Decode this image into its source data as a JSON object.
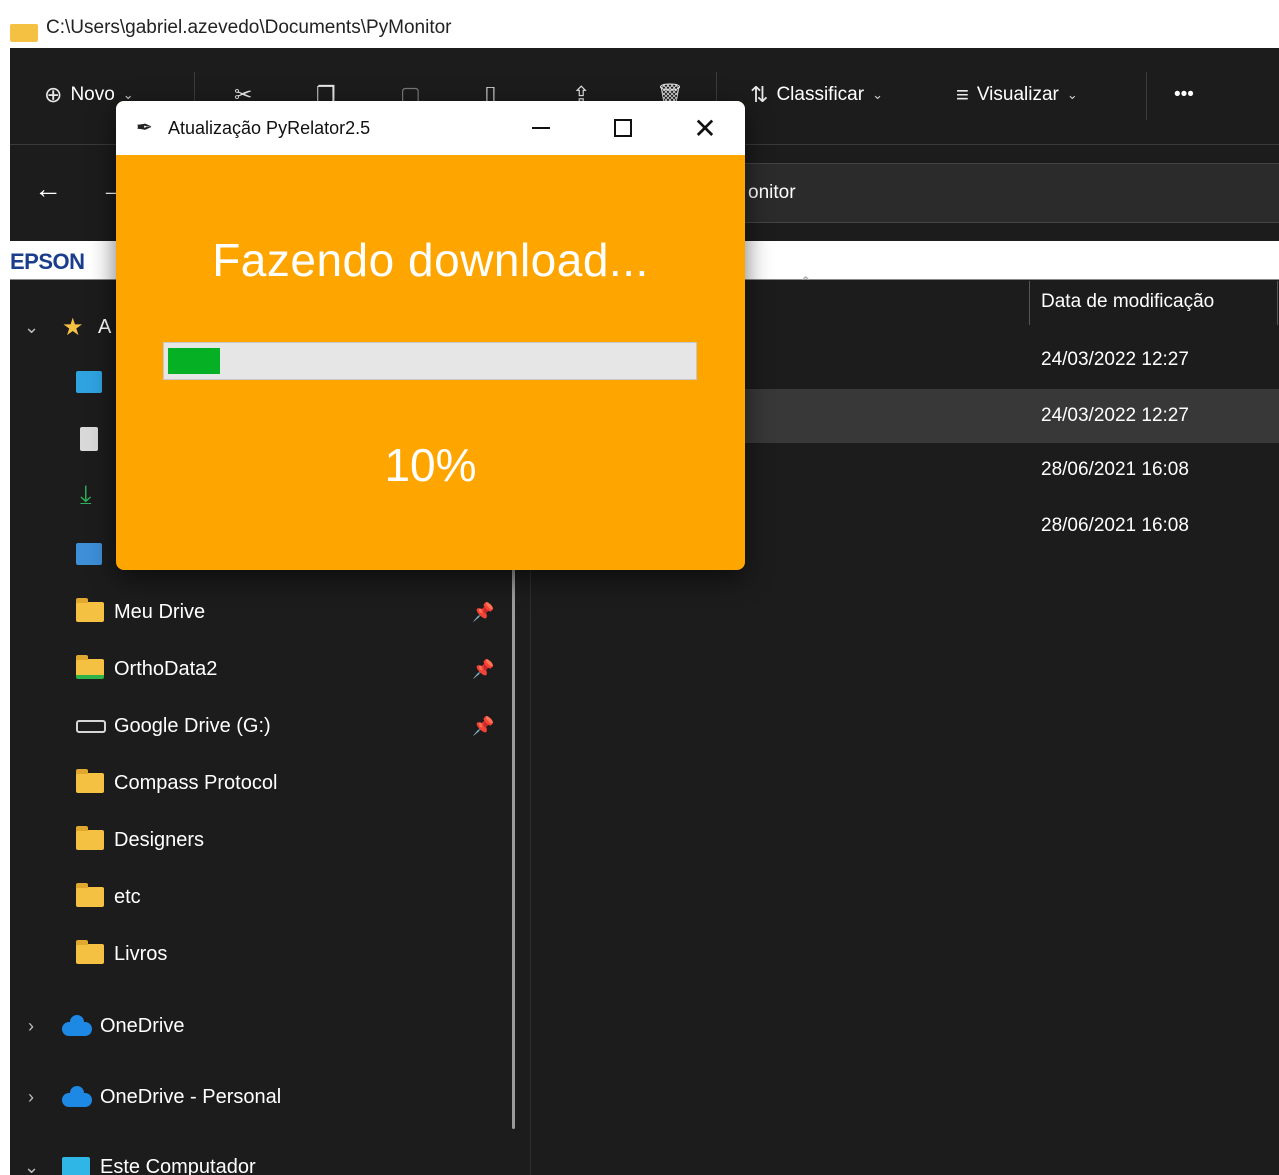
{
  "window": {
    "path": "C:\\Users\\gabriel.azevedo\\Documents\\PyMonitor"
  },
  "toolbar": {
    "new_label": "Novo",
    "sort_label": "Classificar",
    "view_label": "Visualizar",
    "more_label": "•••"
  },
  "address": {
    "partial_text": "onitor"
  },
  "epson": {
    "logo": "EPSON"
  },
  "sidebar": {
    "quick_access_partial": "A",
    "items": [
      {
        "label": "Meu Drive",
        "pinned": true
      },
      {
        "label": "OrthoData2",
        "pinned": true
      },
      {
        "label": "Google Drive (G:)",
        "pinned": true
      },
      {
        "label": "Compass Protocol",
        "pinned": false
      },
      {
        "label": "Designers",
        "pinned": false
      },
      {
        "label": "etc",
        "pinned": false
      },
      {
        "label": "Livros",
        "pinned": false
      }
    ],
    "onedrive": "OneDrive",
    "onedrive_personal": "OneDrive - Personal",
    "this_pc": "Este Computador"
  },
  "content": {
    "column_date": "Data de modificação",
    "rows": [
      {
        "date": "24/03/2022 12:27",
        "selected": false
      },
      {
        "date": "24/03/2022 12:27",
        "selected": true
      },
      {
        "date": "28/06/2021 16:08",
        "selected": false
      },
      {
        "date": "28/06/2021 16:08",
        "selected": false
      }
    ]
  },
  "dialog": {
    "title": "Atualização PyRelator2.5",
    "heading": "Fazendo download...",
    "progress_percent": 10,
    "percent_text": "10%",
    "background_color": "#ffa500",
    "progress_color": "#06b025"
  }
}
